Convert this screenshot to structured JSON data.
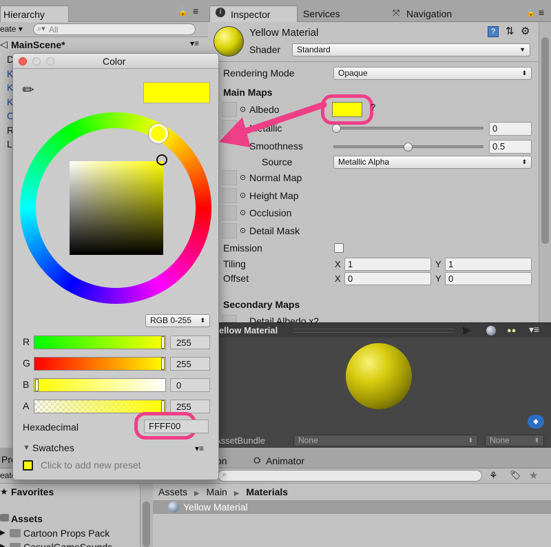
{
  "hierarchy": {
    "tab": "Hierarchy",
    "create": "eate ▾",
    "search_placeholder": "All",
    "scene": "MainScene*",
    "items": [
      "D",
      "K",
      "K",
      "K",
      "C",
      "R",
      "L"
    ]
  },
  "tabs": {
    "inspector": "Inspector",
    "services": "Services",
    "navigation": "Navigation"
  },
  "inspector": {
    "material_name": "Yellow Material",
    "shader_label": "Shader",
    "shader_value": "Standard",
    "rendering_mode_label": "Rendering Mode",
    "rendering_mode_value": "Opaque",
    "main_maps": "Main Maps",
    "albedo": "Albedo",
    "metallic": "Metallic",
    "metallic_value": "0",
    "smoothness": "Smoothness",
    "smoothness_value": "0.5",
    "source": "Source",
    "source_value": "Metallic Alpha",
    "normal_map": "Normal Map",
    "height_map": "Height Map",
    "occlusion": "Occlusion",
    "detail_mask": "Detail Mask",
    "emission": "Emission",
    "tiling": "Tiling",
    "offset": "Offset",
    "tiling_x": "1",
    "tiling_y": "1",
    "offset_x": "0",
    "offset_y": "0",
    "x": "X",
    "y": "Y",
    "secondary_maps": "Secondary Maps",
    "detail_albedo": "Detail Albedo x2",
    "smoothness_level": 0.5
  },
  "preview": {
    "title": "Yellow Material",
    "assetbundle_label": "AssetBundle",
    "bundle_value": "None",
    "variant_value": "None"
  },
  "project": {
    "tab_project": "Pro",
    "tab_animation": "on",
    "tab_animator": "Animator",
    "create": "eate",
    "favorites": "Favorites",
    "assets": "Assets",
    "folders": [
      "Cartoon Props Pack",
      "CasualGameSounds"
    ],
    "breadcrumb": [
      "Assets",
      "Main",
      "Materials"
    ],
    "selected_item": "Yellow Material"
  },
  "color_picker": {
    "title": "Color",
    "mode": "RGB 0-255",
    "r_label": "R",
    "g_label": "G",
    "b_label": "B",
    "a_label": "A",
    "r_value": "255",
    "g_value": "255",
    "b_value": "0",
    "a_value": "255",
    "hex_label": "Hexadecimal",
    "hex_value": "FFFF00",
    "swatches": "Swatches",
    "preset_hint": "Click to add new preset",
    "current_color": "#ffff00"
  },
  "colors": {
    "highlight": "#ef3f87",
    "selected_row": "#9d9d9d"
  }
}
